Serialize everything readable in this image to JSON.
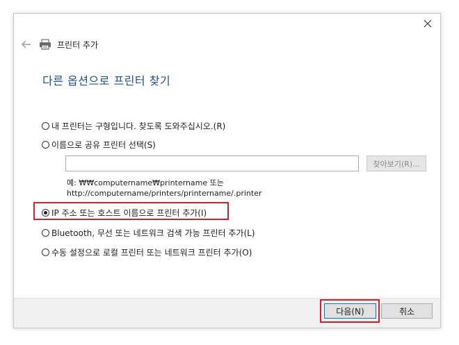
{
  "window": {
    "title": "프린터 추가",
    "heading": "다른 옵션으로 프린터 찾기"
  },
  "icons": {
    "close": "close-icon",
    "back": "back-arrow-icon",
    "printer": "printer-icon"
  },
  "options": [
    {
      "label": "내 프린터는 구형입니다. 찾도록 도와주십시오.(R)",
      "checked": false
    },
    {
      "label": "이름으로 공유 프린터 선택(S)",
      "checked": false
    },
    {
      "label": "IP 주소 또는 호스트 이름으로 프린터 추가(I)",
      "checked": true
    },
    {
      "label": "Bluetooth, 무선 또는 네트워크 검색 가능 프린터 추가(L)",
      "checked": false
    },
    {
      "label": "수동 설정으로 로컬 프린터 또는 네트워크 프린터 추가(O)",
      "checked": false
    }
  ],
  "share": {
    "value": "",
    "browse_label": "찾아보기(R)...",
    "example_line1": "예: ₩₩computername₩printername 또는",
    "example_line2": "http://computername/printers/printername/.printer"
  },
  "footer": {
    "next_label": "다음(N)",
    "cancel_label": "취소"
  },
  "colors": {
    "heading": "#1e4e8c",
    "highlight": "#d0202a",
    "footer_bg": "#f0f0f0",
    "focus_border": "#0078d7"
  }
}
